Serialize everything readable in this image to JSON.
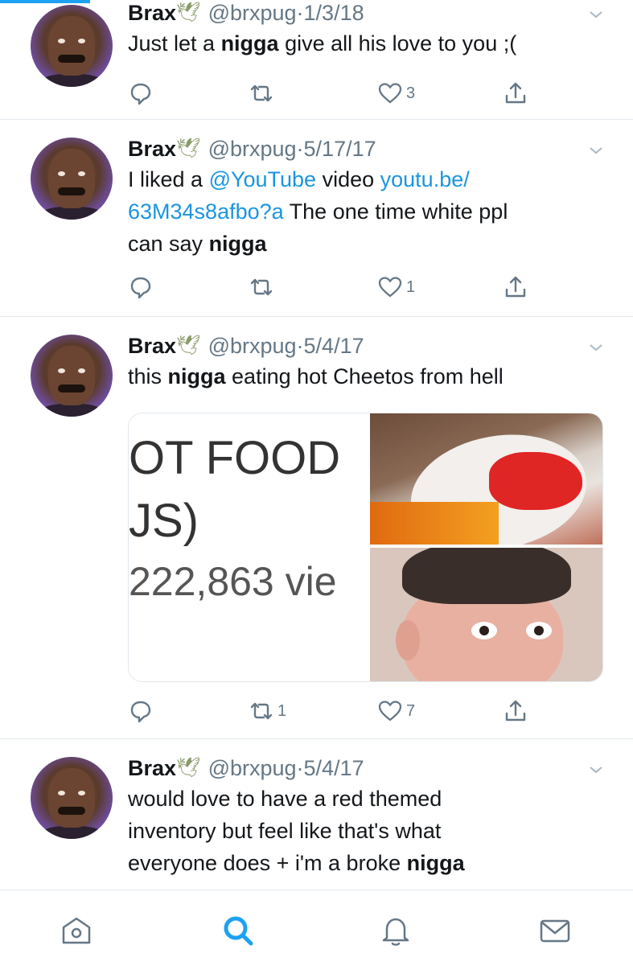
{
  "tweets": [
    {
      "name": "Brax",
      "dove": "🕊",
      "handle": "@brxpug",
      "dot": "·",
      "date": "1/3/18",
      "text_parts": [
        "Just let a ",
        "nigga",
        " give all his love to you ;("
      ],
      "reply_count": "",
      "retweet_count": "",
      "like_count": "3"
    },
    {
      "name": "Brax",
      "dove": "🕊",
      "handle": "@brxpug",
      "dot": "·",
      "date": "5/17/17",
      "text_parts": [
        "I liked a ",
        "@YouTube",
        " video ",
        "youtu.be/",
        "63M34s8afbo?a",
        " The one time white ppl",
        "can say ",
        "nigga"
      ],
      "reply_count": "",
      "retweet_count": "",
      "like_count": "1"
    },
    {
      "name": "Brax",
      "dove": "🕊",
      "handle": "@brxpug",
      "dot": "·",
      "date": "5/4/17",
      "text_parts": [
        "this ",
        "nigga",
        " eating hot Cheetos from hell"
      ],
      "media": {
        "line1": "OT FOOD",
        "line2": "JS)",
        "line3": "222,863 vie"
      },
      "reply_count": "",
      "retweet_count": "1",
      "like_count": "7"
    },
    {
      "name": "Brax",
      "dove": "🕊",
      "handle": "@brxpug",
      "dot": "·",
      "date": "5/4/17",
      "text_parts": [
        "would love to have a red themed",
        "inventory but feel like that's what",
        "everyone does + i'm a broke ",
        "nigga"
      ]
    }
  ],
  "bottom_nav": {
    "items": [
      "home-icon",
      "search-icon",
      "notifications-icon",
      "messages-icon"
    ],
    "active": "search-icon",
    "active_color": "#1da1f2",
    "inactive_color": "#657786"
  },
  "colors": {
    "link": "#1b95e0",
    "muted": "#657786",
    "divider": "#e1e8ed",
    "accent": "#1da1f2"
  }
}
